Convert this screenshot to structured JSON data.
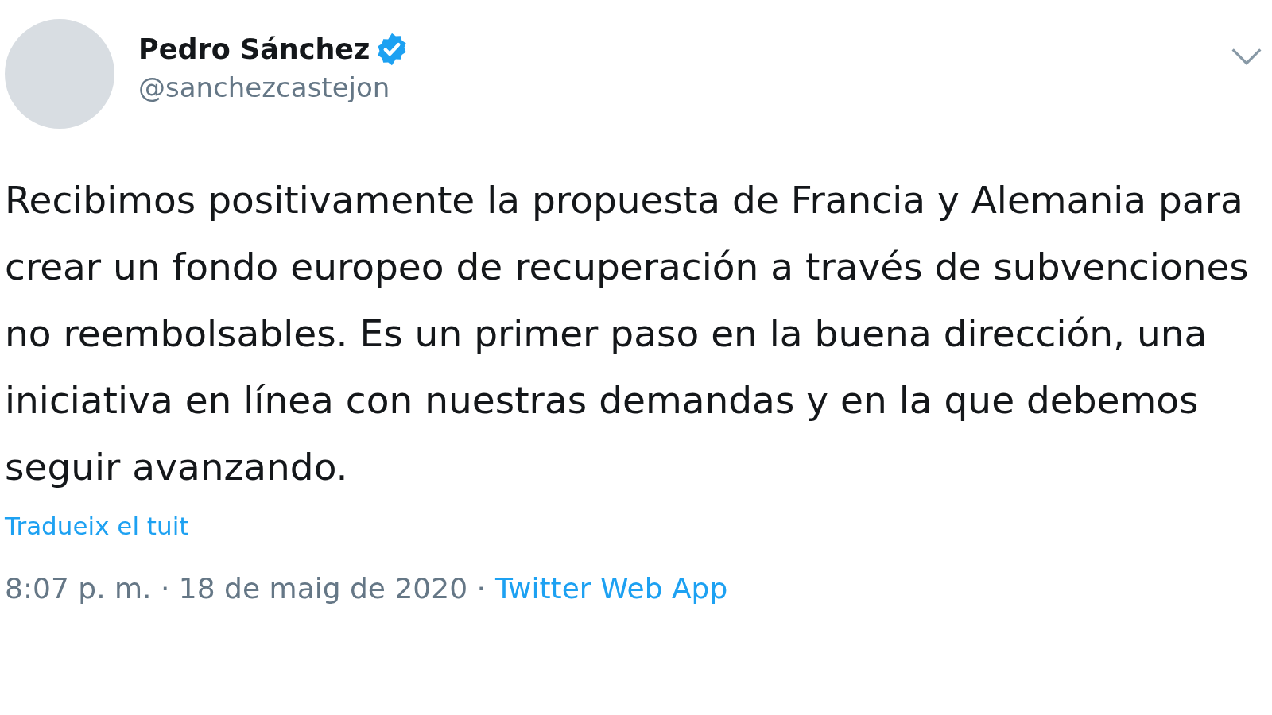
{
  "author": {
    "name": "Pedro Sánchez",
    "verified": true,
    "handle": "@sanchezcastejon"
  },
  "tweet": {
    "text": "Recibimos positivamente la propuesta de Francia y Alemania para crear un fondo europeo de recuperación a través de subvenciones no reembolsables. Es un primer paso en la buena dirección, una iniciativa en línea con nuestras demandas y en la que debemos seguir avanzando.",
    "translate_link": "Tradueix el tuit"
  },
  "footer": {
    "timestamp": "8:07 p. m. · 18 de maig de 2020 ·",
    "source": "Twitter Web App"
  }
}
